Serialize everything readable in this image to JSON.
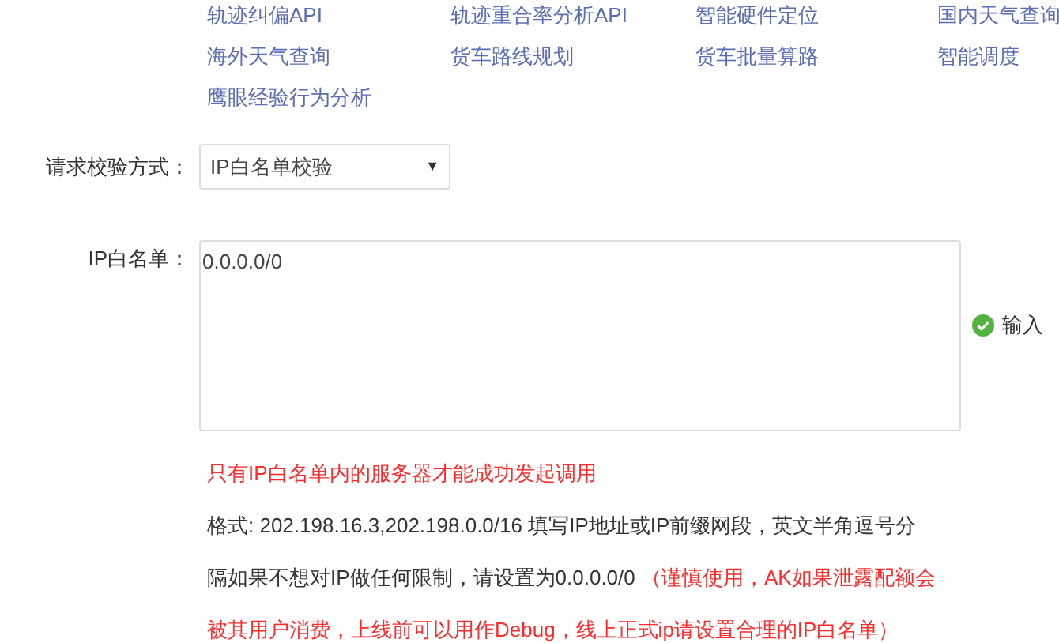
{
  "api_links": [
    {
      "label": "轨迹纠偏API"
    },
    {
      "label": "轨迹重合率分析API"
    },
    {
      "label": "智能硬件定位"
    },
    {
      "label": "国内天气查询"
    },
    {
      "label": "海外天气查询"
    },
    {
      "label": "货车路线规划"
    },
    {
      "label": "货车批量算路"
    },
    {
      "label": "智能调度"
    },
    {
      "label": "鹰眼经验行为分析"
    }
  ],
  "verify_method": {
    "label": "请求校验方式：",
    "value": "IP白名单校验",
    "arrow": "▼"
  },
  "ip_whitelist": {
    "label": "IP白名单：",
    "value": "0.0.0.0/0",
    "status": "输入"
  },
  "notice": "只有IP白名单内的服务器才能成功发起调用",
  "help_lines": [
    [
      {
        "kind": "normal",
        "text": "格式: 202.198.16.3,202.198.0.0/16 填写IP地址或IP前缀网段，英文半角逗号分"
      }
    ],
    [
      {
        "kind": "normal",
        "text": "隔如果不想对IP做任何限制，请设置为0.0.0.0/0 "
      },
      {
        "kind": "warning",
        "text": "（谨慎使用，AK如果泄露配额会"
      }
    ],
    [
      {
        "kind": "warning",
        "text": "被其用户消费，上线前可以用作Debug，线上正式ip请设置合理的IP白名单）"
      }
    ]
  ]
}
